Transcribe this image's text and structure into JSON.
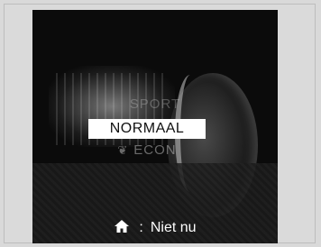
{
  "modes": {
    "above_partial": "SPORT",
    "selected": "NORMAAL",
    "below_partial": "ECON",
    "below_icon": "eco-leaf-icon"
  },
  "footer": {
    "icon": "home-icon",
    "separator": ":",
    "label": "Niet nu"
  }
}
